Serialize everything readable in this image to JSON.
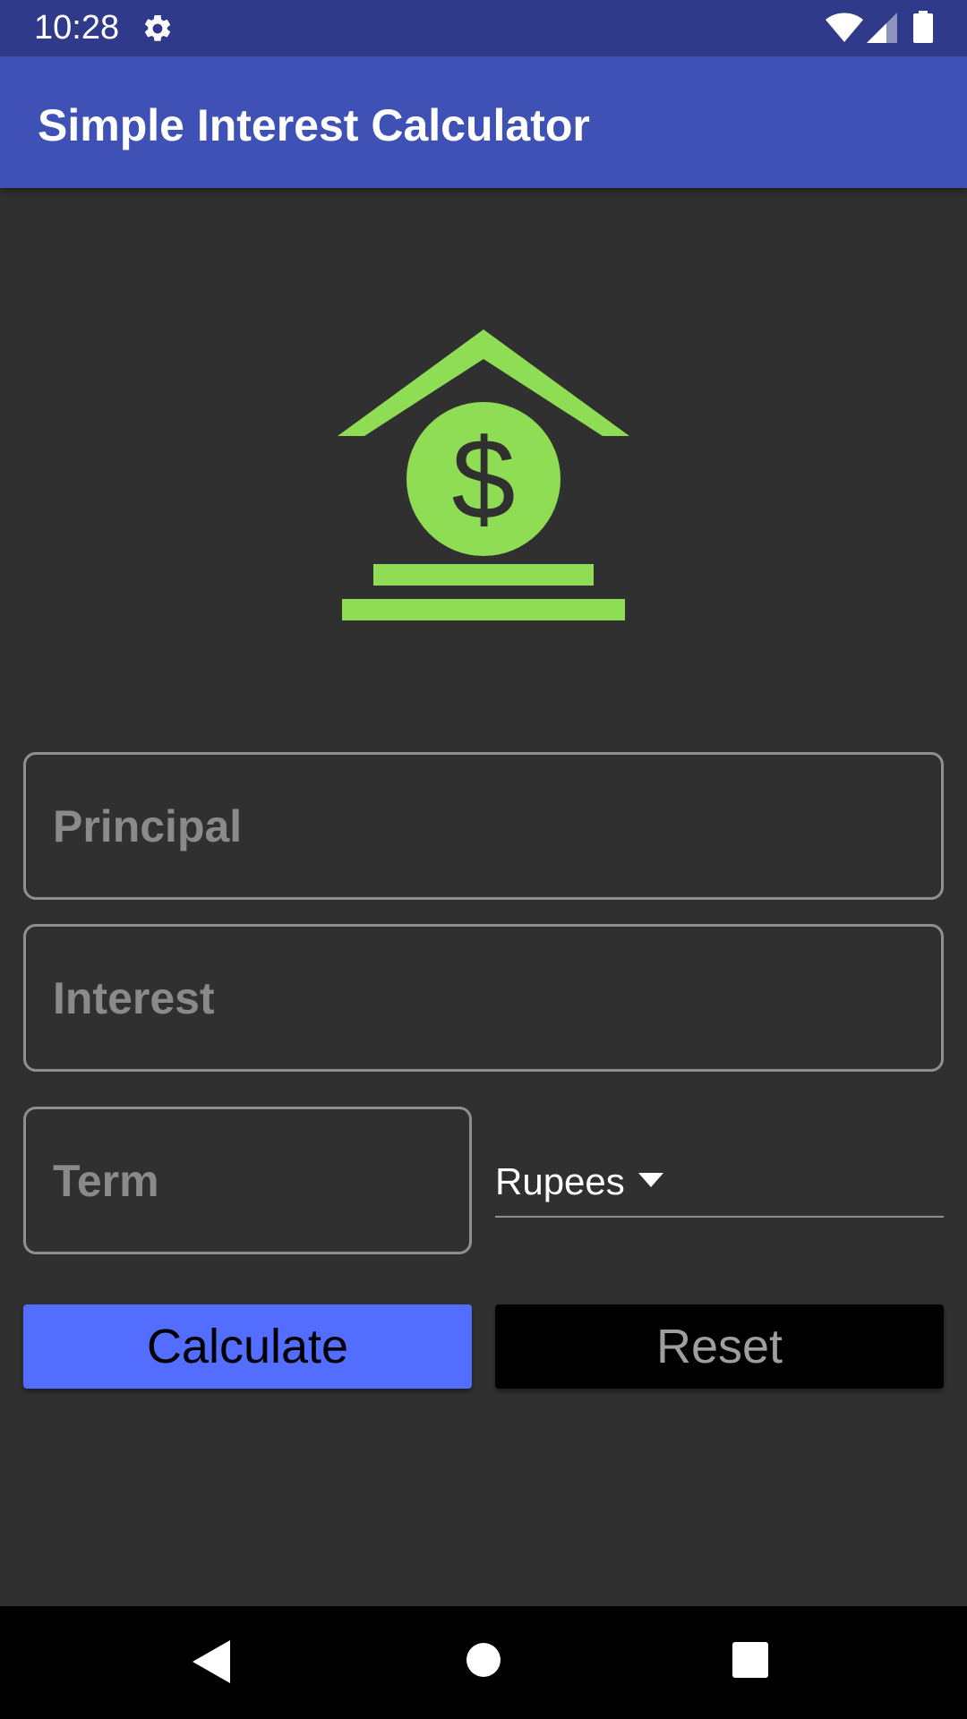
{
  "status_bar": {
    "time": "10:28",
    "icons": [
      "gear-icon",
      "wifi-icon",
      "signal-icon",
      "battery-icon"
    ]
  },
  "app_bar": {
    "title": "Simple Interest Calculator",
    "color": "#3f51b5"
  },
  "logo": {
    "icon": "bank-dollar-icon",
    "color": "#8fdd55"
  },
  "form": {
    "principal": {
      "placeholder": "Principal",
      "value": ""
    },
    "interest": {
      "placeholder": "Interest",
      "value": ""
    },
    "term": {
      "placeholder": "Term",
      "value": ""
    },
    "currency": {
      "selected": "Rupees"
    }
  },
  "buttons": {
    "calculate": {
      "label": "Calculate",
      "color": "#536dfe"
    },
    "reset": {
      "label": "Reset",
      "color": "#000000"
    }
  },
  "nav_bar": {
    "icons": [
      "back-icon",
      "home-icon",
      "recents-icon"
    ]
  }
}
